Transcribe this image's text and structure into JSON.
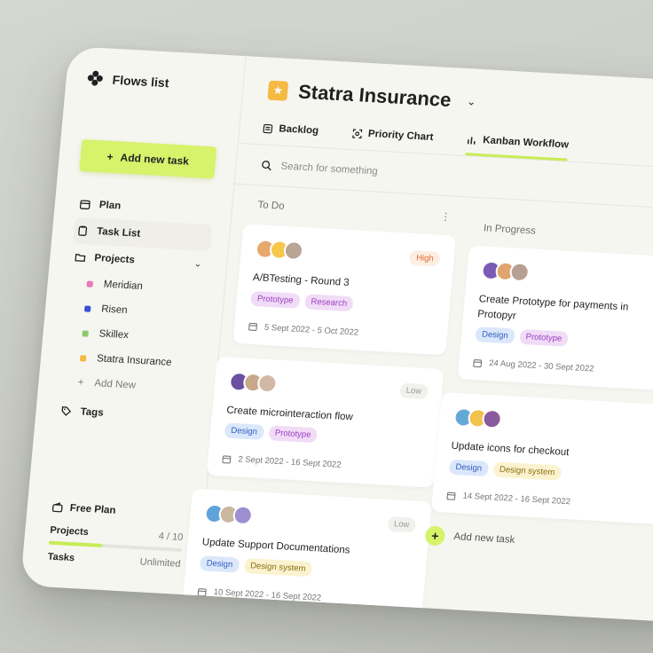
{
  "sidebar": {
    "brand": "Flows list",
    "add_task_label": "Add new task",
    "nav": {
      "plan": "Plan",
      "task_list": "Task List",
      "projects": "Projects",
      "tags": "Tags"
    },
    "projects": [
      {
        "name": "Meridian",
        "color": "#e879b9"
      },
      {
        "name": "Risen",
        "color": "#3b4fd8"
      },
      {
        "name": "Skillex",
        "color": "#8cc96b"
      },
      {
        "name": "Statra Insurance",
        "color": "#f5b944"
      }
    ],
    "add_new_label": "Add New",
    "plan": {
      "title": "Free Plan",
      "projects_label": "Projects",
      "projects_value": "4 / 10",
      "projects_fraction": 0.4,
      "tasks_label": "Tasks",
      "tasks_value": "Unlimited"
    }
  },
  "header": {
    "title": "Statra Insurance"
  },
  "tabs": [
    {
      "label": "Backlog",
      "icon": "backlog-icon"
    },
    {
      "label": "Priority Chart",
      "icon": "priority-chart-icon"
    },
    {
      "label": "Kanban Workflow",
      "icon": "kanban-icon",
      "active": true
    }
  ],
  "search": {
    "placeholder": "Search for something"
  },
  "columns": [
    {
      "name": "To Do",
      "cards": [
        {
          "priority": "High",
          "title": "A/BTesting - Round 3",
          "tags": [
            "Prototype",
            "Research"
          ],
          "date": "5 Sept 2022 - 5 Oct 2022"
        },
        {
          "priority": "Low",
          "title": "Create microinteraction flow",
          "tags": [
            "Design",
            "Prototype"
          ],
          "date": "2 Sept 2022 - 16 Sept 2022"
        },
        {
          "priority": "Low",
          "title": "Update Support Documentations",
          "tags": [
            "Design",
            "Design system"
          ],
          "date": "10 Sept 2022 - 16 Sept 2022"
        }
      ]
    },
    {
      "name": "In Progress",
      "cards": [
        {
          "priority": "",
          "title": "Create Prototype for payments in Protopyr",
          "tags": [
            "Design",
            "Prototype"
          ],
          "date": "24 Aug 2022 - 30 Sept 2022"
        },
        {
          "priority": "",
          "title": "Update icons for checkout",
          "tags": [
            "Design",
            "Design system"
          ],
          "date": "14 Sept 2022 - 16 Sept 2022"
        }
      ],
      "add_task_label": "Add new task"
    }
  ],
  "colors": {
    "accent": "#d7f26b",
    "tag_prototype": "#f1dcf7",
    "tag_research": "#f1dcf7",
    "tag_design": "#dbe7fb",
    "tag_design_system": "#fbf3cf"
  }
}
